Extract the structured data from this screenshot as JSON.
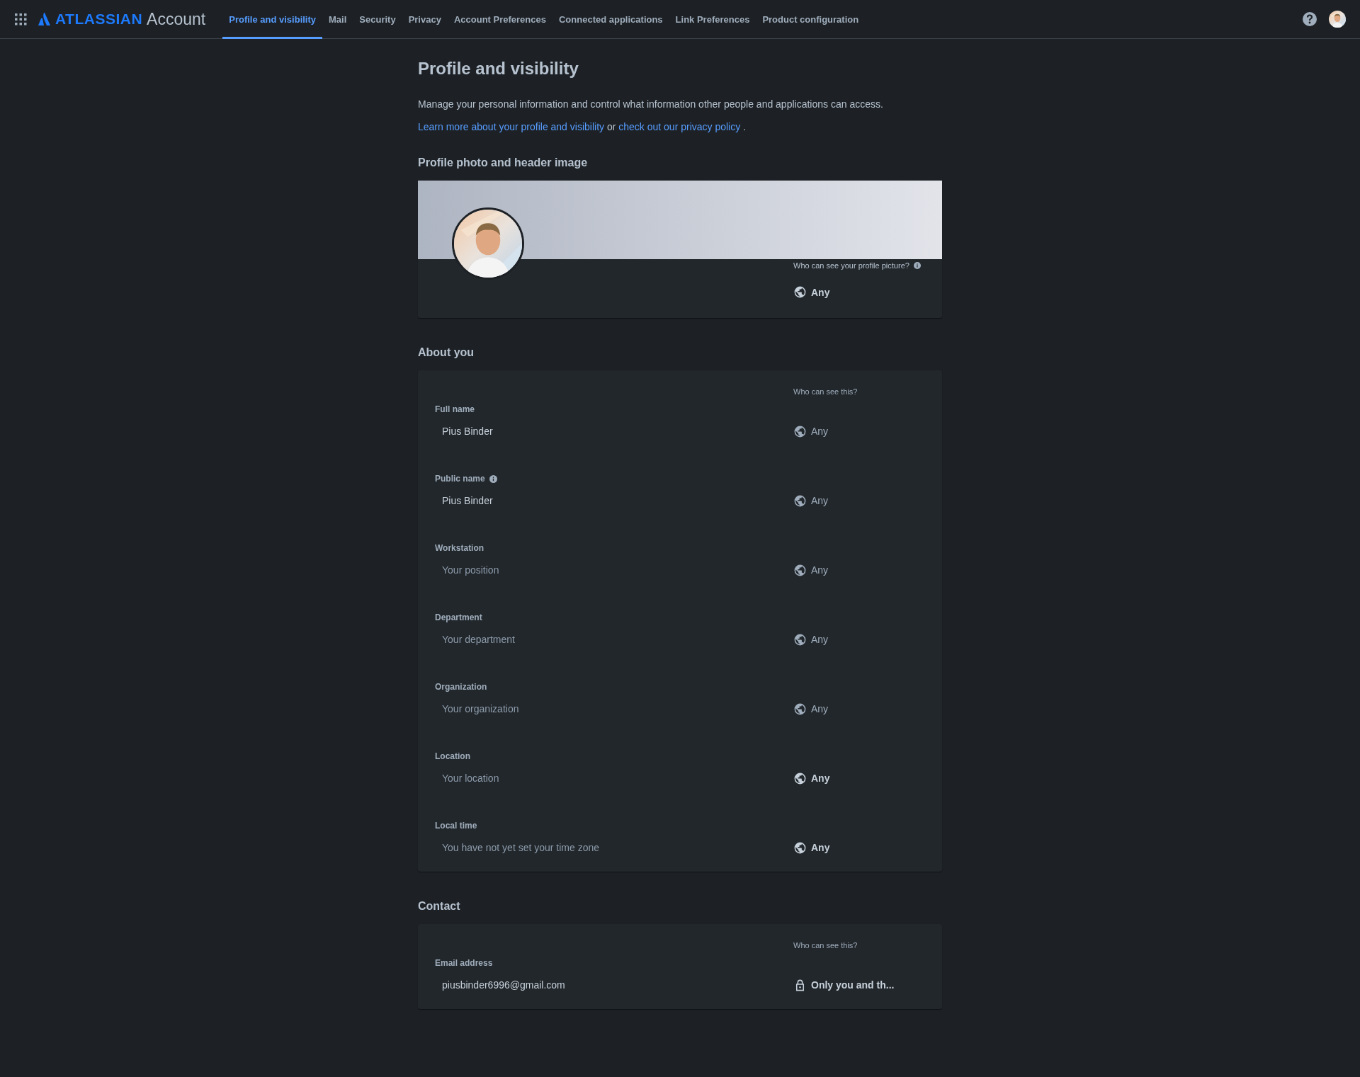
{
  "nav": {
    "brand": "ATLASSIAN",
    "product": "Account",
    "tabs": [
      {
        "label": "Profile and visibility",
        "selected": true
      },
      {
        "label": "Mail",
        "selected": false
      },
      {
        "label": "Security",
        "selected": false
      },
      {
        "label": "Privacy",
        "selected": false
      },
      {
        "label": "Account Preferences",
        "selected": false
      },
      {
        "label": "Connected applications",
        "selected": false
      },
      {
        "label": "Link Preferences",
        "selected": false
      },
      {
        "label": "Product configuration",
        "selected": false
      }
    ]
  },
  "page": {
    "title": "Profile and visibility",
    "intro": "Manage your personal information and control what information other people and applications can access.",
    "learn_link": "Learn more about your profile and visibility",
    "joiner": "or",
    "privacy_link": "check out our privacy policy",
    "end": "."
  },
  "photo_section": {
    "title": "Profile photo and header image",
    "question": "Who can see your profile picture?",
    "visibility": {
      "kind": "globe",
      "label": "Any",
      "emphasized": true
    }
  },
  "about": {
    "title": "About you",
    "question": "Who can see this?",
    "fields": [
      {
        "label": "Full name",
        "info": false,
        "value": "Pius Binder",
        "visibility": {
          "kind": "globe",
          "label": "Any",
          "emphasized": false
        }
      },
      {
        "label": "Public name",
        "info": true,
        "value": "Pius Binder",
        "visibility": {
          "kind": "globe",
          "label": "Any",
          "emphasized": false
        }
      },
      {
        "label": "Workstation",
        "info": false,
        "placeholder": "Your position",
        "visibility": {
          "kind": "globe",
          "label": "Any",
          "emphasized": false
        }
      },
      {
        "label": "Department",
        "info": false,
        "placeholder": "Your department",
        "visibility": {
          "kind": "globe",
          "label": "Any",
          "emphasized": false
        }
      },
      {
        "label": "Organization",
        "info": false,
        "placeholder": "Your organization",
        "visibility": {
          "kind": "globe",
          "label": "Any",
          "emphasized": false
        }
      },
      {
        "label": "Location",
        "info": false,
        "placeholder": "Your location",
        "visibility": {
          "kind": "globe",
          "label": "Any",
          "emphasized": true
        }
      },
      {
        "label": "Local time",
        "info": false,
        "placeholder": "You have not yet set your time zone",
        "visibility": {
          "kind": "globe",
          "label": "Any",
          "emphasized": true
        }
      }
    ]
  },
  "contact": {
    "title": "Contact",
    "question": "Who can see this?",
    "fields": [
      {
        "label": "Email address",
        "info": false,
        "value": "piusbinder6996@gmail.com",
        "visibility": {
          "kind": "lock",
          "label": "Only you and th...",
          "emphasized": true
        }
      }
    ]
  }
}
